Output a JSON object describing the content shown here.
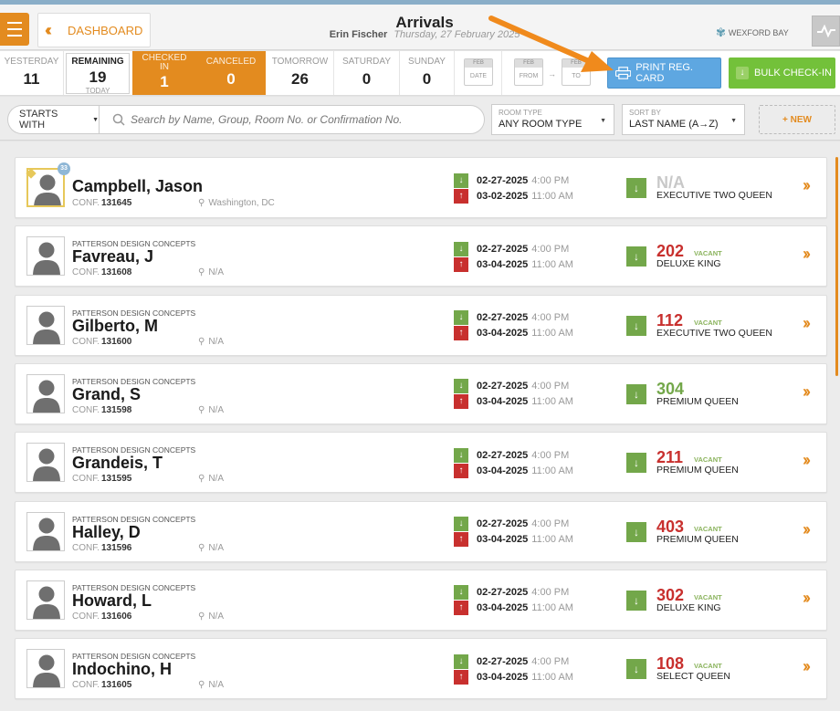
{
  "header": {
    "dashboard_label": "DASHBOARD",
    "title": "Arrivals",
    "user": "Erin Fischer",
    "date": "Thursday, 27 February 2025",
    "hotel": "WEXFORD BAY"
  },
  "tabs": [
    {
      "label": "YESTERDAY",
      "count": "11"
    },
    {
      "label": "REMAINING",
      "count": "19",
      "sublabel": "TODAY"
    },
    {
      "label": "CHECKED IN",
      "count": "1"
    },
    {
      "label": "CANCELED",
      "count": "0"
    },
    {
      "label": "TOMORROW",
      "count": "26"
    },
    {
      "label": "SATURDAY",
      "count": "0"
    },
    {
      "label": "SUNDAY",
      "count": "0"
    }
  ],
  "date_pickers": {
    "month": "FEB",
    "date": "DATE",
    "from": "FROM",
    "to": "TO"
  },
  "actions": {
    "print_reg_card": "PRINT REG. CARD",
    "bulk_checkin": "BULK CHECK-IN"
  },
  "filters": {
    "starts_with": "STARTS WITH",
    "search_placeholder": "Search by Name, Group, Room No. or Confirmation No.",
    "room_type_label": "ROOM TYPE",
    "room_type_value": "ANY ROOM TYPE",
    "sort_label": "SORT BY",
    "sort_value": "LAST NAME (A→Z)",
    "new_label": "+ NEW"
  },
  "conf_label": "CONF.",
  "vacant_label": "VACANT",
  "colors": {
    "accent": "#e38b1f",
    "print_blue": "#5ea7e1",
    "checkin_green": "#73c13a",
    "room_red": "#c8302e",
    "room_green": "#73a74a"
  },
  "reservations": [
    {
      "company": "",
      "name": "Campbell, Jason",
      "conf": "131645",
      "location": "Washington, DC",
      "arrive_date": "02-27-2025",
      "arrive_time": "4:00 PM",
      "depart_date": "03-02-2025",
      "depart_time": "11:00 AM",
      "room": "N/A",
      "room_status": "",
      "room_type": "EXECUTIVE TWO QUEEN",
      "vip": true,
      "badge": "33"
    },
    {
      "company": "PATTERSON DESIGN CONCEPTS",
      "name": "Favreau, J",
      "conf": "131608",
      "location": "N/A",
      "arrive_date": "02-27-2025",
      "arrive_time": "4:00 PM",
      "depart_date": "03-04-2025",
      "depart_time": "11:00 AM",
      "room": "202",
      "room_status": "VACANT",
      "room_type": "DELUXE KING"
    },
    {
      "company": "PATTERSON DESIGN CONCEPTS",
      "name": "Gilberto, M",
      "conf": "131600",
      "location": "N/A",
      "arrive_date": "02-27-2025",
      "arrive_time": "4:00 PM",
      "depart_date": "03-04-2025",
      "depart_time": "11:00 AM",
      "room": "112",
      "room_status": "VACANT",
      "room_type": "EXECUTIVE TWO QUEEN"
    },
    {
      "company": "PATTERSON DESIGN CONCEPTS",
      "name": "Grand, S",
      "conf": "131598",
      "location": "N/A",
      "arrive_date": "02-27-2025",
      "arrive_time": "4:00 PM",
      "depart_date": "03-04-2025",
      "depart_time": "11:00 AM",
      "room": "304",
      "room_status": "",
      "room_type": "PREMIUM QUEEN"
    },
    {
      "company": "PATTERSON DESIGN CONCEPTS",
      "name": "Grandeis, T",
      "conf": "131595",
      "location": "N/A",
      "arrive_date": "02-27-2025",
      "arrive_time": "4:00 PM",
      "depart_date": "03-04-2025",
      "depart_time": "11:00 AM",
      "room": "211",
      "room_status": "VACANT",
      "room_type": "PREMIUM QUEEN"
    },
    {
      "company": "PATTERSON DESIGN CONCEPTS",
      "name": "Halley, D",
      "conf": "131596",
      "location": "N/A",
      "arrive_date": "02-27-2025",
      "arrive_time": "4:00 PM",
      "depart_date": "03-04-2025",
      "depart_time": "11:00 AM",
      "room": "403",
      "room_status": "VACANT",
      "room_type": "PREMIUM QUEEN"
    },
    {
      "company": "PATTERSON DESIGN CONCEPTS",
      "name": "Howard, L",
      "conf": "131606",
      "location": "N/A",
      "arrive_date": "02-27-2025",
      "arrive_time": "4:00 PM",
      "depart_date": "03-04-2025",
      "depart_time": "11:00 AM",
      "room": "302",
      "room_status": "VACANT",
      "room_type": "DELUXE KING"
    },
    {
      "company": "PATTERSON DESIGN CONCEPTS",
      "name": "Indochino, H",
      "conf": "131605",
      "location": "N/A",
      "arrive_date": "02-27-2025",
      "arrive_time": "4:00 PM",
      "depart_date": "03-04-2025",
      "depart_time": "11:00 AM",
      "room": "108",
      "room_status": "VACANT",
      "room_type": "SELECT QUEEN"
    }
  ]
}
